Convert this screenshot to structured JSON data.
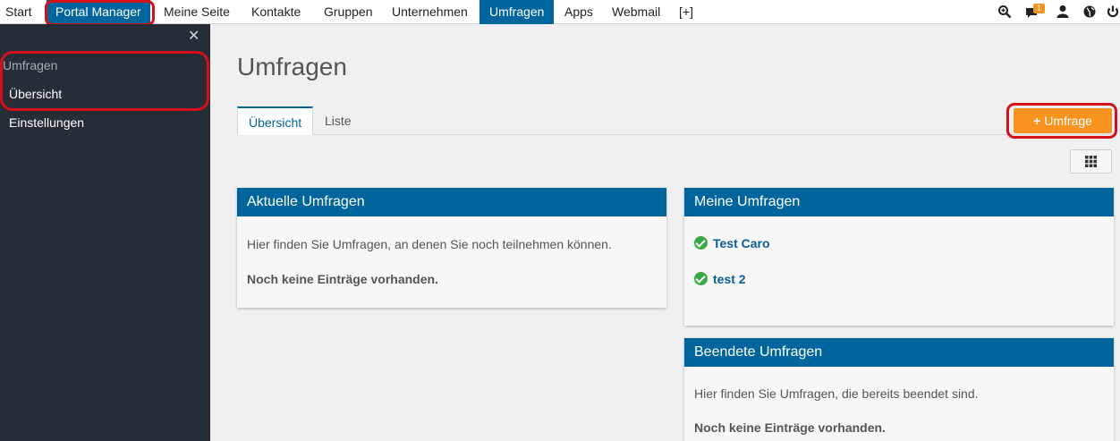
{
  "nav": {
    "items": [
      "Start",
      "Portal Manager",
      "Meine Seite",
      "Kontakte",
      "Gruppen",
      "Unternehmen",
      "Umfragen",
      "Apps",
      "Webmail",
      "[+]"
    ],
    "notification_count": "1",
    "icons": [
      "search-icon",
      "chat-icon",
      "user-icon",
      "globe-icon",
      "power-icon"
    ]
  },
  "sidebar": {
    "section_title": "Umfragen",
    "items": [
      "Übersicht",
      "Einstellungen"
    ]
  },
  "main": {
    "title": "Umfragen",
    "tabs": [
      "Übersicht",
      "Liste"
    ],
    "add_button": "Umfrage"
  },
  "cards": {
    "current": {
      "title": "Aktuelle Umfragen",
      "text": "Hier finden Sie Umfragen, an denen Sie noch teilnehmen können.",
      "empty": "Noch keine Einträge vorhanden."
    },
    "mine": {
      "title": "Meine Umfragen",
      "entries": [
        "Test Caro",
        "test 2"
      ]
    },
    "finished": {
      "title": "Beendete Umfragen",
      "text": "Hier finden Sie Umfragen, die bereits beendet sind.",
      "empty": "Noch keine Einträge vorhanden."
    }
  },
  "colors": {
    "nav_active": "#00659c",
    "sidebar_bg": "#272d36",
    "accent_orange": "#f7931e",
    "annotation_red": "#d5101b",
    "check_green": "#3aa845"
  }
}
